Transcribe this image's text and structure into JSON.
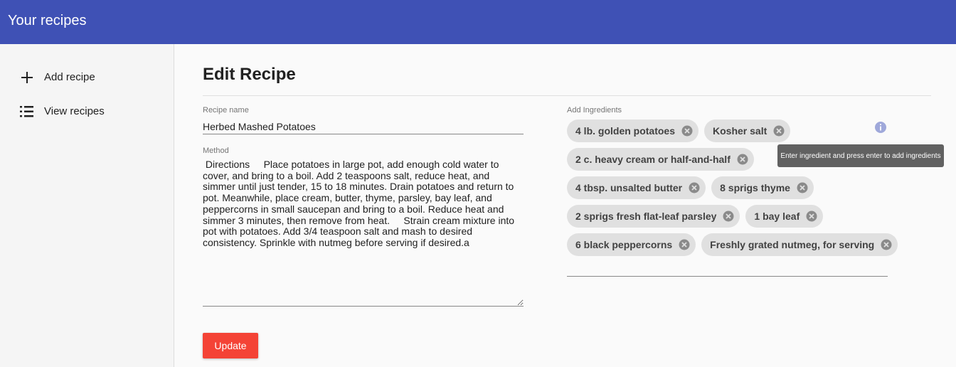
{
  "appbar": {
    "title": "Your recipes",
    "color": "#3f51b5"
  },
  "sidebar": {
    "items": [
      {
        "label": "Add recipe",
        "icon": "plus-icon"
      },
      {
        "label": "View recipes",
        "icon": "list-icon"
      }
    ]
  },
  "main": {
    "title": "Edit Recipe",
    "recipe_name": {
      "label": "Recipe name",
      "value": "Herbed Mashed Potatoes"
    },
    "method": {
      "label": "Method",
      "value": " Directions     Place potatoes in large pot, add enough cold water to cover, and bring to a boil. Add 2 teaspoons salt, reduce heat, and simmer until just tender, 15 to 18 minutes. Drain potatoes and return to pot. Meanwhile, place cream, butter, thyme, parsley, bay leaf, and peppercorns in small saucepan and bring to a boil. Reduce heat and simmer 3 minutes, then remove from heat.     Strain cream mixture into pot with potatoes. Add 3/4 teaspoon salt and mash to desired consistency. Sprinkle with nutmeg before serving if desired.a"
    },
    "update_label": "Update",
    "update_color": "#f44336"
  },
  "ingredients": {
    "label": "Add Ingredients",
    "tooltip": "Enter ingredient and press enter to add ingredients",
    "info_icon": "info-icon",
    "chips": [
      "4 lb. golden potatoes",
      "Kosher salt",
      "2 c. heavy cream or half-and-half",
      "4 tbsp. unsalted butter",
      "8 sprigs thyme",
      "2 sprigs fresh flat-leaf parsley",
      "1 bay leaf",
      "6 black peppercorns",
      "Freshly grated nutmeg, for serving"
    ]
  }
}
